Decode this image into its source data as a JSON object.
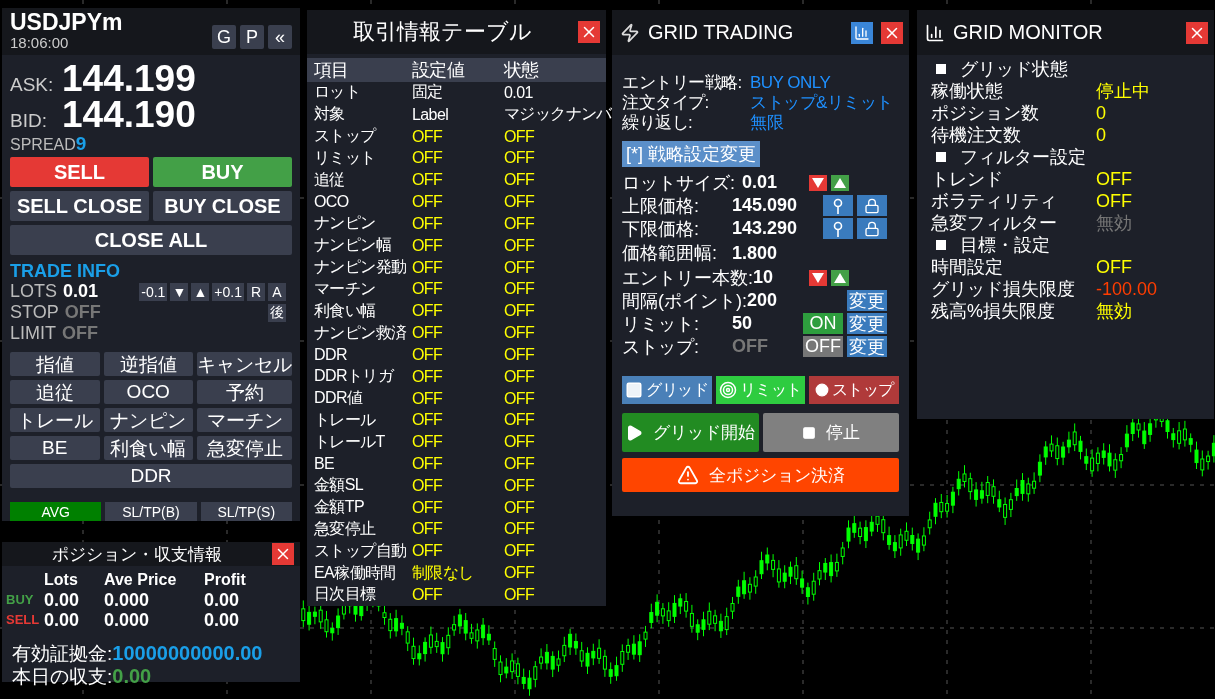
{
  "symbol_panel": {
    "symbol": "USDJPYm",
    "time": "18:06:00",
    "header_buttons": [
      "G",
      "P",
      "«"
    ],
    "ask_label": "ASK:",
    "ask": "144.199",
    "bid_label": "BID:",
    "bid": "144.190",
    "spread_label": "SPREAD",
    "spread": "9",
    "trade_buttons": [
      {
        "label": "SELL",
        "kind": "sell"
      },
      {
        "label": "BUY",
        "kind": "buy"
      }
    ],
    "close_buttons": [
      "SELL CLOSE",
      "BUY CLOSE"
    ],
    "close_all": "CLOSE ALL",
    "trade_info": {
      "title": "TRADE INFO",
      "lots_label": "LOTS",
      "lots": "0.01",
      "lot_buttons": [
        "-0.1",
        "▼",
        "▲",
        "+0.1",
        "R",
        "A"
      ],
      "stop_label": "STOP",
      "stop": "OFF",
      "limit_label": "LIMIT",
      "limit": "OFF",
      "after_button": "後"
    },
    "order_buttons": [
      "指値",
      "逆指値",
      "キャンセル",
      "追従",
      "OCO",
      "予約",
      "トレール",
      "ナンピン",
      "マーチン",
      "BE",
      "利食い幅",
      "急変停止",
      "DDR"
    ],
    "mode_buttons": [
      {
        "label": "AVG",
        "selected": true
      },
      {
        "label": "SL/TP(B)",
        "selected": false
      },
      {
        "label": "SL/TP(S)",
        "selected": false
      }
    ]
  },
  "position_panel": {
    "title": "ポジション・収支情報",
    "columns": [
      "Lots",
      "Ave Price",
      "Profit"
    ],
    "rows": [
      {
        "side": "BUY",
        "kind": "buy",
        "values": [
          "0.00",
          "0.000",
          "0.00"
        ]
      },
      {
        "side": "SELL",
        "kind": "sell",
        "values": [
          "0.00",
          "0.000",
          "0.00"
        ]
      }
    ],
    "equity_label": "有効証拠金:",
    "equity": "10000000000.00",
    "today_label": "本日の収支:",
    "today": "0.00"
  },
  "info_table": {
    "title": "取引情報テーブル",
    "columns": [
      "項目",
      "設定値",
      "状態"
    ],
    "rows": [
      {
        "kind": "info",
        "item": "ロット",
        "setting": "固定",
        "state": "0.01"
      },
      {
        "kind": "info",
        "item": "対象",
        "setting": "Label",
        "state": "マジックナンバ"
      },
      {
        "kind": "switch",
        "item": "ストップ",
        "setting": "OFF",
        "state": "OFF"
      },
      {
        "kind": "switch",
        "item": "リミット",
        "setting": "OFF",
        "state": "OFF"
      },
      {
        "kind": "switch",
        "item": "追従",
        "setting": "OFF",
        "state": "OFF"
      },
      {
        "kind": "switch",
        "item": "OCO",
        "setting": "OFF",
        "state": "OFF"
      },
      {
        "kind": "switch",
        "item": "ナンピン",
        "setting": "OFF",
        "state": "OFF"
      },
      {
        "kind": "switch",
        "item": "ナンピン幅",
        "setting": "OFF",
        "state": "OFF"
      },
      {
        "kind": "switch",
        "item": "ナンピン発動",
        "setting": "OFF",
        "state": "OFF"
      },
      {
        "kind": "switch",
        "item": "マーチン",
        "setting": "OFF",
        "state": "OFF"
      },
      {
        "kind": "switch",
        "item": "利食い幅",
        "setting": "OFF",
        "state": "OFF"
      },
      {
        "kind": "switch",
        "item": "ナンピン救済",
        "setting": "OFF",
        "state": "OFF"
      },
      {
        "kind": "switch",
        "item": "DDR",
        "setting": "OFF",
        "state": "OFF"
      },
      {
        "kind": "switch",
        "item": "DDRトリガ",
        "setting": "OFF",
        "state": "OFF"
      },
      {
        "kind": "switch",
        "item": "DDR値",
        "setting": "OFF",
        "state": "OFF"
      },
      {
        "kind": "switch",
        "item": "トレール",
        "setting": "OFF",
        "state": "OFF"
      },
      {
        "kind": "switch",
        "item": "トレールT",
        "setting": "OFF",
        "state": "OFF"
      },
      {
        "kind": "switch",
        "item": "BE",
        "setting": "OFF",
        "state": "OFF"
      },
      {
        "kind": "switch",
        "item": "金額SL",
        "setting": "OFF",
        "state": "OFF"
      },
      {
        "kind": "switch",
        "item": "金額TP",
        "setting": "OFF",
        "state": "OFF"
      },
      {
        "kind": "switch",
        "item": "急変停止",
        "setting": "OFF",
        "state": "OFF"
      },
      {
        "kind": "switch",
        "item": "ストップ自動",
        "setting": "OFF",
        "state": "OFF"
      },
      {
        "kind": "switch",
        "item": "EA稼働時間",
        "setting": "制限なし",
        "state": "OFF"
      },
      {
        "kind": "switch",
        "item": "日次目標",
        "setting": "OFF",
        "state": "OFF"
      }
    ]
  },
  "grid_trading": {
    "title": "GRID TRADING",
    "strategy": [
      {
        "label": "エントリー戦略:",
        "value": "BUY ONLY"
      },
      {
        "label": "注文タイプ:",
        "value": "ストップ&リミット"
      },
      {
        "label": "繰り返し:",
        "value": "無限"
      }
    ],
    "strategy_button": "[*] 戦略設定変更",
    "settings": [
      {
        "kind": "stepper",
        "label": "ロットサイズ:",
        "value": "0.01"
      },
      {
        "kind": "pin",
        "label": "上限価格:",
        "value": "145.090"
      },
      {
        "kind": "pin",
        "label": "下限価格:",
        "value": "143.290"
      },
      {
        "kind": "plain",
        "label": "価格範囲幅:",
        "value": "1.800"
      },
      {
        "kind": "stepper",
        "label": "エントリー本数:",
        "value": "10"
      },
      {
        "kind": "change",
        "label": "間隔(ポイント):",
        "value": "200",
        "button": "変更"
      },
      {
        "kind": "toggle",
        "label": "リミット:",
        "value": "50",
        "on": true,
        "toggle": "ON",
        "button": "変更"
      },
      {
        "kind": "toggle",
        "label": "ストップ:",
        "value": "OFF",
        "on": false,
        "toggle": "OFF",
        "button": "変更"
      }
    ],
    "line_buttons": [
      {
        "kind": "grid",
        "label": "グリッド"
      },
      {
        "kind": "limit",
        "label": "リミット"
      },
      {
        "kind": "stop",
        "label": "ストップ"
      }
    ],
    "start_button": "グリッド開始",
    "stop_button": "停止",
    "close_all_button": "全ポジション決済"
  },
  "grid_monitor": {
    "title": "GRID MONITOR",
    "sections": [
      {
        "title": "グリッド状態",
        "rows": [
          {
            "label": "稼働状態",
            "value": "停止中",
            "kind": "normal"
          },
          {
            "label": "ポジション数",
            "value": "0",
            "kind": "normal"
          },
          {
            "label": "待機注文数",
            "value": "0",
            "kind": "normal"
          }
        ]
      },
      {
        "title": "フィルター設定",
        "rows": [
          {
            "label": "トレンド",
            "value": "OFF",
            "kind": "normal"
          },
          {
            "label": "ボラティリティ",
            "value": "OFF",
            "kind": "normal"
          },
          {
            "label": "急変フィルター",
            "value": "無効",
            "kind": "muted"
          }
        ]
      },
      {
        "title": "目標・設定",
        "rows": [
          {
            "label": "時間設定",
            "value": "OFF",
            "kind": "normal"
          },
          {
            "label": "グリッド損失限度",
            "value": "-100.00",
            "kind": "alert"
          },
          {
            "label": "残高%損失限度",
            "value": "無効",
            "kind": "normal"
          }
        ]
      }
    ]
  }
}
